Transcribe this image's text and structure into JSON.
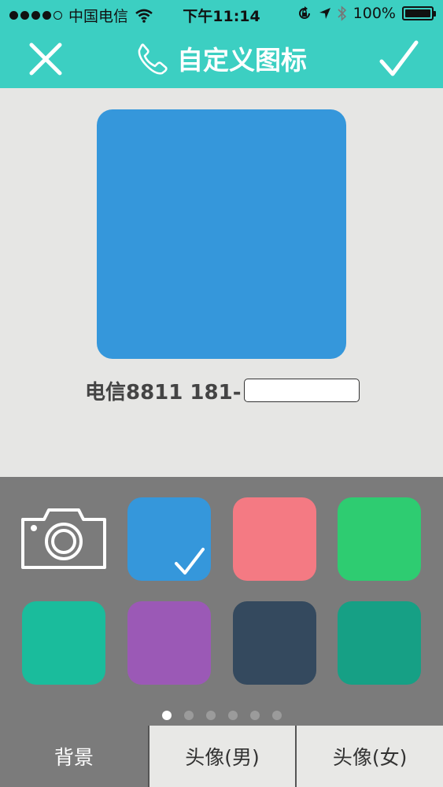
{
  "status_bar": {
    "carrier": "中国电信",
    "time": "下午11:14",
    "battery": "100%"
  },
  "nav": {
    "title": "自定义图标",
    "close_icon": "close-icon",
    "confirm_icon": "checkmark-icon",
    "phone_icon": "phone-icon"
  },
  "preview": {
    "color": "#3597db",
    "contact_label": "电信8811 181-"
  },
  "palette": {
    "selected_index": 0,
    "swatches": [
      {
        "color": "#3597db"
      },
      {
        "color": "#f47a83"
      },
      {
        "color": "#2ecc71"
      },
      {
        "color": "#1abc9c"
      },
      {
        "color": "#9b59b6"
      },
      {
        "color": "#34495e"
      },
      {
        "color": "#16a085"
      }
    ],
    "page_count": 6,
    "current_page": 1
  },
  "tabs": [
    {
      "label": "背景",
      "active": true
    },
    {
      "label": "头像(男)",
      "active": false
    },
    {
      "label": "头像(女)",
      "active": false
    }
  ],
  "colors": {
    "header": "#3ccfc2",
    "palette_bg": "#7b7b7b",
    "page_bg": "#e6e6e4"
  }
}
